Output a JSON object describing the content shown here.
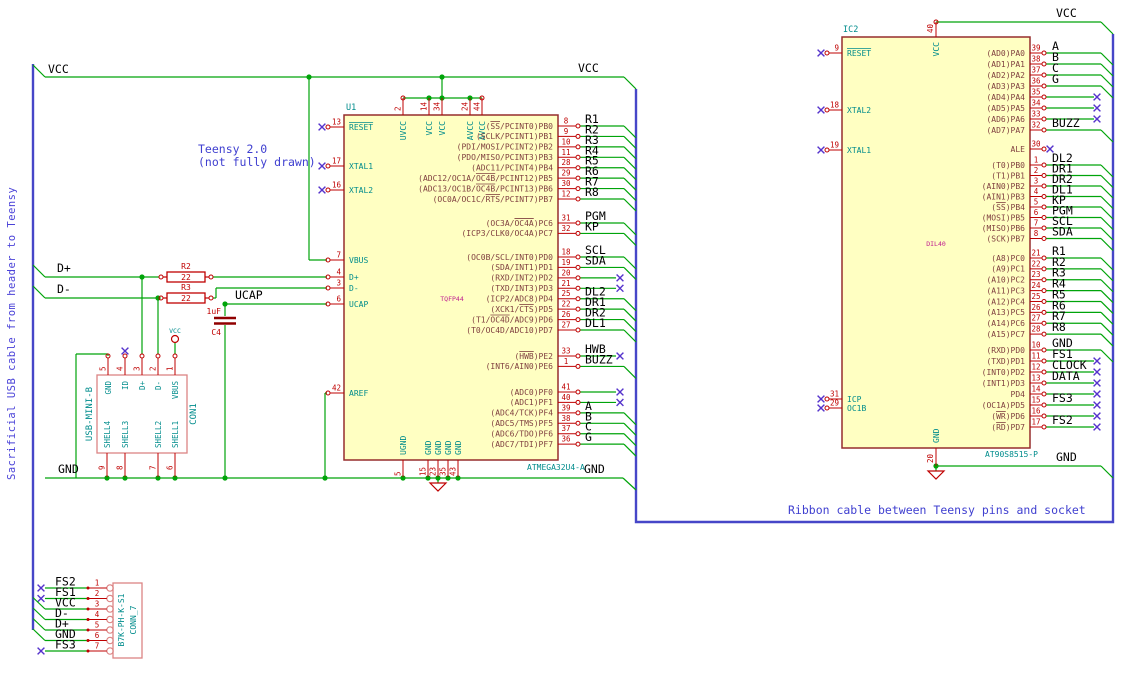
{
  "notes": {
    "teensy1": "Teensy 2.0",
    "teensy2": "(not fully drawn)",
    "ribbon": "Ribbon cable between Teensy pins and socket",
    "side": "Sacrificial USB cable from header to Teensy"
  },
  "colors": {
    "wire": "#00a40a",
    "bus": "#4646c8",
    "pin": "#bf0000",
    "outline": "#962d2d",
    "fill": "#ffffc2",
    "teal": "#008c8c",
    "mname": "#804040",
    "magenta": "#c02090",
    "note": "#4040d0",
    "nc": "#5533cc",
    "conn": "#dc8484",
    "plate": "#900000",
    "label": "#000000"
  },
  "nets": {
    "vcc_left": "VCC",
    "vcc_mid": "VCC",
    "vcc_right": "VCC",
    "vcc_usb": "VCC",
    "gnd_left": "GND",
    "gnd_mid": "GND",
    "gnd_right": "GND",
    "dplus": "D+",
    "dminus": "D-",
    "ucap": "UCAP"
  },
  "u1": {
    "ref": "U1",
    "package": "TQFP44",
    "part": "ATMEGA32U4-A",
    "top_pins": [
      {
        "num": "2",
        "name": "UVCC"
      },
      {
        "num": "14",
        "name": "VCC"
      },
      {
        "num": "34",
        "name": "VCC"
      },
      {
        "num": "24",
        "name": "AVCC"
      },
      {
        "num": "44",
        "name": "AVCC"
      }
    ],
    "left_pins": [
      {
        "num": "13",
        "name": "~RESET~",
        "conn": "nc"
      },
      {
        "num": "17",
        "name": "XTAL1",
        "conn": "nc"
      },
      {
        "num": "16",
        "name": "XTAL2",
        "conn": "nc"
      },
      {
        "num": "7",
        "name": "VBUS",
        "conn": "wire"
      },
      {
        "num": "4",
        "name": "D+",
        "conn": "wire"
      },
      {
        "num": "3",
        "name": "D-",
        "conn": "wire"
      },
      {
        "num": "6",
        "name": "UCAP",
        "conn": "wire"
      },
      {
        "num": "42",
        "name": "AREF",
        "conn": "wire"
      }
    ],
    "bottom_pins": [
      {
        "num": "5",
        "name": "UGND"
      },
      {
        "num": "15",
        "name": "GND"
      },
      {
        "num": "23",
        "name": "GND"
      },
      {
        "num": "35",
        "name": "GND"
      },
      {
        "num": "43",
        "name": "GND"
      }
    ],
    "right_groups": [
      {
        "pins": [
          {
            "num": "8",
            "name": "(~SS~/PCINT0)PB0",
            "label": "R1",
            "conn": "bus"
          },
          {
            "num": "9",
            "name": "(SCLK/PCINT1)PB1",
            "label": "R2",
            "conn": "bus"
          },
          {
            "num": "10",
            "name": "(PDI/MOSI/PCINT2)PB2",
            "label": "R3",
            "conn": "bus"
          },
          {
            "num": "11",
            "name": "(PDO/MISO/PCINT3)PB3",
            "label": "R4",
            "conn": "bus"
          },
          {
            "num": "28",
            "name": "(ADC11/PCINT4)PB4",
            "label": "R5",
            "conn": "bus"
          },
          {
            "num": "29",
            "name": "(ADC12/OC1A/~OC4B~/PCINT12)PB5",
            "label": "R6",
            "conn": "bus"
          },
          {
            "num": "30",
            "name": "(ADC13/OC1B/~OC4B~/PCINT13)PB6",
            "label": "R7",
            "conn": "bus"
          },
          {
            "num": "12",
            "name": "(OC0A/OC1C/~RTS~/PCINT7)PB7",
            "label": "R8",
            "conn": "bus"
          }
        ]
      },
      {
        "pins": [
          {
            "num": "31",
            "name": "(OC3A/~OC4A~)PC6",
            "label": "PGM",
            "conn": "bus"
          },
          {
            "num": "32",
            "name": "(ICP3/CLK0/OC4A)PC7",
            "label": "KP",
            "conn": "bus"
          }
        ]
      },
      {
        "pins": [
          {
            "num": "18",
            "name": "(OC0B/SCL/INT0)PD0",
            "label": "SCL",
            "conn": "bus"
          },
          {
            "num": "19",
            "name": "(SDA/INT1)PD1",
            "label": "SDA",
            "conn": "bus"
          },
          {
            "num": "20",
            "name": "(RXD/INT2)PD2",
            "label": "",
            "conn": "nc"
          },
          {
            "num": "21",
            "name": "(TXD/INT3)PD3",
            "label": "",
            "conn": "nc"
          },
          {
            "num": "25",
            "name": "(ICP2/ADC8)PD4",
            "label": "DL2",
            "conn": "bus"
          },
          {
            "num": "22",
            "name": "(XCK1/~CTS~)PD5",
            "label": "DR1",
            "conn": "bus"
          },
          {
            "num": "26",
            "name": "(T1/~OC4D~/ADC9)PD6",
            "label": "DR2",
            "conn": "bus"
          },
          {
            "num": "27",
            "name": "(T0/OC4D/ADC10)PD7",
            "label": "DL1",
            "conn": "bus"
          }
        ]
      },
      {
        "pins": [
          {
            "num": "33",
            "name": "(~HWB~)PE2",
            "label": "HWB",
            "conn": "nc"
          },
          {
            "num": "1",
            "name": "(INT6/AIN0)PE6",
            "label": "BUZZ",
            "conn": "bus"
          }
        ]
      },
      {
        "pins": [
          {
            "num": "41",
            "name": "(ADC0)PF0",
            "label": "",
            "conn": "nc"
          },
          {
            "num": "40",
            "name": "(ADC1)PF1",
            "label": "",
            "conn": "nc"
          },
          {
            "num": "39",
            "name": "(ADC4/TCK)PF4",
            "label": "A",
            "conn": "bus"
          },
          {
            "num": "38",
            "name": "(ADC5/TMS)PF5",
            "label": "B",
            "conn": "bus"
          },
          {
            "num": "37",
            "name": "(ADC6/TDO)PF6",
            "label": "C",
            "conn": "bus"
          },
          {
            "num": "36",
            "name": "(ADC7/TDI)PF7",
            "label": "G",
            "conn": "bus"
          }
        ]
      }
    ]
  },
  "ic2": {
    "ref": "IC2",
    "package": "DIL40",
    "part": "AT90S8515-P",
    "top_pin": {
      "num": "40",
      "name": "VCC"
    },
    "bottom_pin": {
      "num": "20",
      "name": "GND"
    },
    "left_pins": [
      {
        "num": "9",
        "name": "~RESET~",
        "conn": "nc"
      },
      {
        "num": "18",
        "name": "XTAL2",
        "conn": "nc"
      },
      {
        "num": "19",
        "name": "XTAL1",
        "conn": "nc"
      },
      {
        "num": "31",
        "name": "ICP",
        "conn": "nc"
      },
      {
        "num": "29",
        "name": "OC1B",
        "conn": "nc"
      }
    ],
    "right_groups": [
      {
        "pins": [
          {
            "num": "39",
            "name": "(AD0)PA0",
            "label": "A",
            "conn": "bus"
          },
          {
            "num": "38",
            "name": "(AD1)PA1",
            "label": "B",
            "conn": "bus"
          },
          {
            "num": "37",
            "name": "(AD2)PA2",
            "label": "C",
            "conn": "bus"
          },
          {
            "num": "36",
            "name": "(AD3)PA3",
            "label": "G",
            "conn": "bus"
          },
          {
            "num": "35",
            "name": "(AD4)PA4",
            "label": "",
            "conn": "nc"
          },
          {
            "num": "34",
            "name": "(AD5)PA5",
            "label": "",
            "conn": "nc"
          },
          {
            "num": "33",
            "name": "(AD6)PA6",
            "label": "",
            "conn": "nc"
          },
          {
            "num": "32",
            "name": "(AD7)PA7",
            "label": "BUZZ",
            "conn": "bus"
          }
        ]
      },
      {
        "pins": [
          {
            "num": "30",
            "name": "ALE",
            "label": "",
            "conn": "ncpin"
          }
        ]
      },
      {
        "pins": [
          {
            "num": "1",
            "name": "(T0)PB0",
            "label": "DL2",
            "conn": "bus"
          },
          {
            "num": "2",
            "name": "(T1)PB1",
            "label": "DR1",
            "conn": "bus"
          },
          {
            "num": "3",
            "name": "(AIN0)PB2",
            "label": "DR2",
            "conn": "bus"
          },
          {
            "num": "4",
            "name": "(AIN1)PB3",
            "label": "DL1",
            "conn": "bus"
          },
          {
            "num": "5",
            "name": "(~SS~)PB4",
            "label": "KP",
            "conn": "bus"
          },
          {
            "num": "6",
            "name": "(MOSI)PB5",
            "label": "PGM",
            "conn": "bus"
          },
          {
            "num": "7",
            "name": "(MISO)PB6",
            "label": "SCL",
            "conn": "bus"
          },
          {
            "num": "8",
            "name": "(SCK)PB7",
            "label": "SDA",
            "conn": "bus"
          }
        ]
      },
      {
        "pins": [
          {
            "num": "21",
            "name": "(A8)PC0",
            "label": "R1",
            "conn": "bus"
          },
          {
            "num": "22",
            "name": "(A9)PC1",
            "label": "R2",
            "conn": "bus"
          },
          {
            "num": "23",
            "name": "(A10)PC2",
            "label": "R3",
            "conn": "bus"
          },
          {
            "num": "24",
            "name": "(A11)PC3",
            "label": "R4",
            "conn": "bus"
          },
          {
            "num": "25",
            "name": "(A12)PC4",
            "label": "R5",
            "conn": "bus"
          },
          {
            "num": "26",
            "name": "(A13)PC5",
            "label": "R6",
            "conn": "bus"
          },
          {
            "num": "27",
            "name": "(A14)PC6",
            "label": "R7",
            "conn": "bus"
          },
          {
            "num": "28",
            "name": "(A15)PC7",
            "label": "R8",
            "conn": "bus"
          }
        ]
      },
      {
        "pins": [
          {
            "num": "10",
            "name": "(RXD)PD0",
            "label": "GND",
            "conn": "bus"
          },
          {
            "num": "11",
            "name": "(TXD)PD1",
            "label": "FS1",
            "conn": "nc"
          },
          {
            "num": "12",
            "name": "(INT0)PD2",
            "label": "CLOCK",
            "conn": "nc"
          },
          {
            "num": "13",
            "name": "(INT1)PD3",
            "label": "DATA",
            "conn": "nc"
          },
          {
            "num": "14",
            "name": "PD4",
            "label": "",
            "conn": "nc"
          },
          {
            "num": "15",
            "name": "(OC1A)PD5",
            "label": "FS3",
            "conn": "nc"
          },
          {
            "num": "16",
            "name": "(~WR~)PD6",
            "label": "",
            "conn": "nc"
          },
          {
            "num": "17",
            "name": "(~RD~)PD7",
            "label": "FS2",
            "conn": "nc"
          }
        ]
      }
    ]
  },
  "r2": {
    "ref": "R2",
    "value": "22"
  },
  "r3": {
    "ref": "R3",
    "value": "22"
  },
  "c4": {
    "ref": "C4",
    "value": "1uF"
  },
  "usb": {
    "ref": "CON1",
    "value": "USB-MINI-B",
    "top_pins": [
      {
        "num": "5",
        "name": "GND"
      },
      {
        "num": "4",
        "name": "ID"
      },
      {
        "num": "3",
        "name": "D+"
      },
      {
        "num": "2",
        "name": "D-"
      },
      {
        "num": "1",
        "name": "VBUS"
      }
    ],
    "bottom_pins": [
      {
        "num": "9",
        "name": "SHELL4"
      },
      {
        "num": "8",
        "name": "SHELL3"
      },
      {
        "num": "7",
        "name": "SHELL2"
      },
      {
        "num": "6",
        "name": "SHELL1"
      }
    ]
  },
  "conn7": {
    "ref": "CONN_7",
    "value": "B7K-PH-K-S1",
    "pins": [
      {
        "num": "1",
        "label": "FS2",
        "conn": "nc"
      },
      {
        "num": "2",
        "label": "FS1",
        "conn": "nc"
      },
      {
        "num": "3",
        "label": "VCC",
        "conn": "bus"
      },
      {
        "num": "4",
        "label": "D-",
        "conn": "bus"
      },
      {
        "num": "5",
        "label": "D+",
        "conn": "bus"
      },
      {
        "num": "6",
        "label": "GND",
        "conn": "bus"
      },
      {
        "num": "7",
        "label": "FS3",
        "conn": "nc"
      }
    ]
  }
}
